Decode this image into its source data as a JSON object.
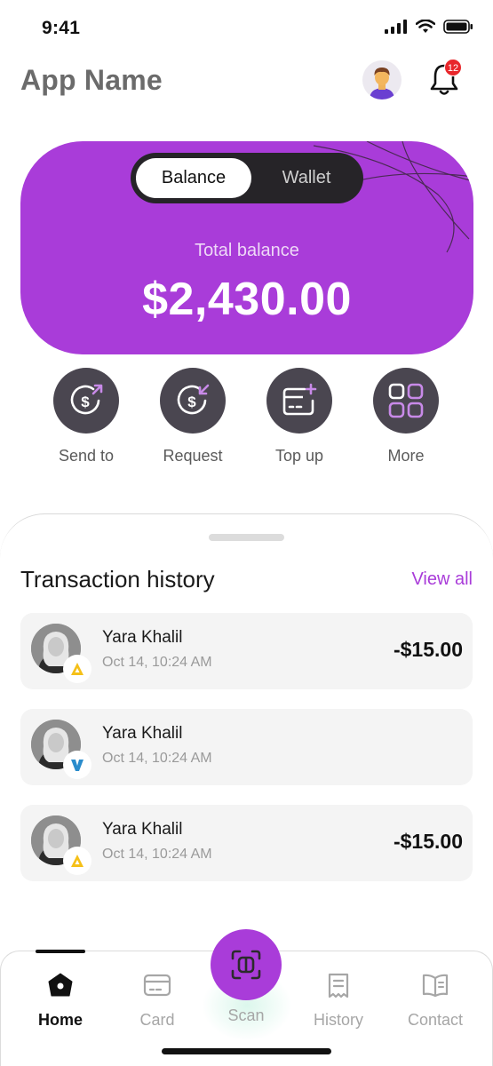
{
  "status_bar": {
    "time": "9:41"
  },
  "header": {
    "app_name": "App Name",
    "notification_count": "12",
    "avatar_icon": "user-avatar",
    "bell_icon": "bell-icon"
  },
  "balance_card": {
    "tabs": [
      "Balance",
      "Wallet"
    ],
    "active_tab": "Balance",
    "total_label": "Total balance",
    "total_amount": "$2,430.00",
    "color": "#a93cd9"
  },
  "quick_actions": [
    {
      "label": "Send to",
      "icon": "send-money-icon"
    },
    {
      "label": "Request",
      "icon": "request-money-icon"
    },
    {
      "label": "Top up",
      "icon": "top-up-card-icon"
    },
    {
      "label": "More",
      "icon": "grid-icon"
    }
  ],
  "transactions": {
    "title": "Transaction history",
    "view_all": "View all",
    "items": [
      {
        "name": "Yara Khalil",
        "date": "Oct 14, 10:24 AM",
        "amount": "-$15.00",
        "brand_icon": "yellow-a-logo-icon"
      },
      {
        "name": "Yara Khalil",
        "date": "Oct 14, 10:24 AM",
        "amount": "",
        "brand_icon": "blue-v-logo-icon"
      },
      {
        "name": "Yara Khalil",
        "date": "Oct 14, 10:24 AM",
        "amount": "-$15.00",
        "brand_icon": "yellow-a-logo-icon"
      }
    ]
  },
  "bottom_nav": {
    "items": [
      {
        "label": "Home",
        "icon": "home-icon",
        "active": true
      },
      {
        "label": "Card",
        "icon": "card-icon",
        "active": false
      },
      {
        "label": "Scan",
        "icon": "scan-icon",
        "active": false
      },
      {
        "label": "History",
        "icon": "receipt-icon",
        "active": false
      },
      {
        "label": "Contact",
        "icon": "book-icon",
        "active": false
      }
    ]
  },
  "colors": {
    "accent": "#a93cd9",
    "dark": "#4a4650",
    "badge": "#e8262b"
  }
}
